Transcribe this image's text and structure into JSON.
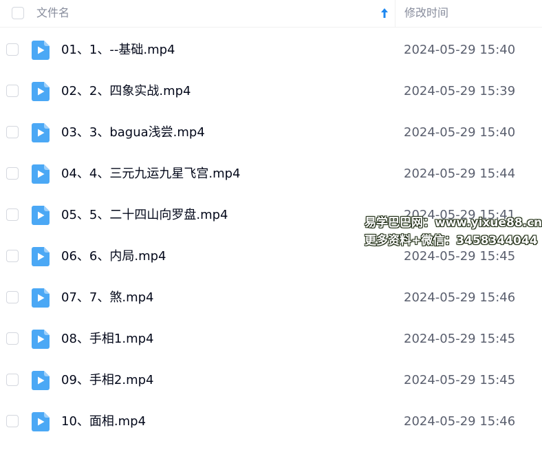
{
  "header": {
    "name_label": "文件名",
    "date_label": "修改时间",
    "sort_icon": "arrow-up-icon"
  },
  "files": [
    {
      "name": "01、1、--基础.mp4",
      "modified": "2024-05-29 15:40"
    },
    {
      "name": "02、2、四象实战.mp4",
      "modified": "2024-05-29 15:39"
    },
    {
      "name": "03、3、bagua浅尝.mp4",
      "modified": "2024-05-29 15:40"
    },
    {
      "name": "04、4、三元九运九星飞宫.mp4",
      "modified": "2024-05-29 15:44"
    },
    {
      "name": "05、5、二十四山向罗盘.mp4",
      "modified": "2024-05-29 15:41"
    },
    {
      "name": "06、6、内局.mp4",
      "modified": "2024-05-29 15:45"
    },
    {
      "name": "07、7、煞.mp4",
      "modified": "2024-05-29 15:46"
    },
    {
      "name": "08、手相1.mp4",
      "modified": "2024-05-29 15:45"
    },
    {
      "name": "09、手相2.mp4",
      "modified": "2024-05-29 15:45"
    },
    {
      "name": "10、面相.mp4",
      "modified": "2024-05-29 15:46"
    }
  ],
  "file_icon": "video-file-icon",
  "colors": {
    "icon_blue": "#4ba8f5",
    "sort_arrow": "#1e88f0"
  },
  "watermark": {
    "line1": "易学巴巴网：www.yixue88.cn",
    "line2": "更多资料+微信：3458344044"
  }
}
